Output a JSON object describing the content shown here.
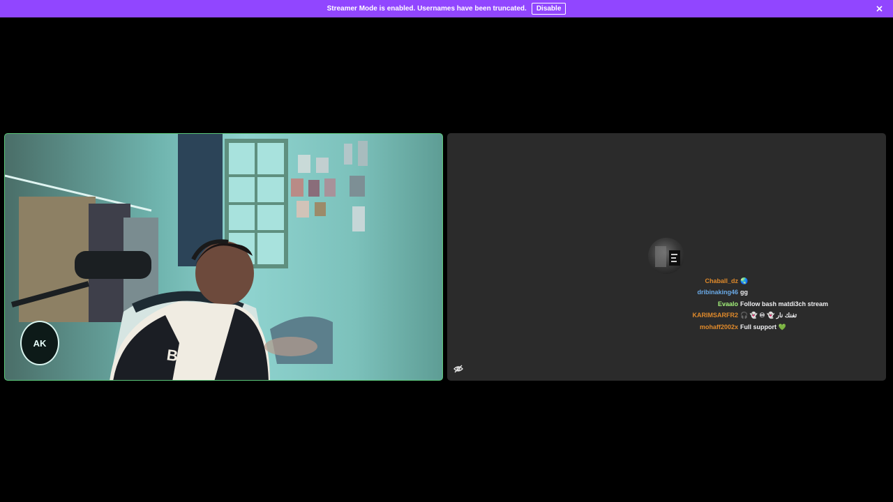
{
  "banner": {
    "message": "Streamer Mode is enabled. Usernames have been truncated.",
    "disable_label": "Disable",
    "color": "#9146ff"
  },
  "camera_tile": {
    "border_color": "#5bc97a",
    "logo_text": "AK"
  },
  "chat_tile": {
    "messages": [
      {
        "user": "Chaball_dz",
        "text": "🌏",
        "color": "#e08a2b"
      },
      {
        "user": "dribinaking46",
        "text": "gg",
        "color": "#6aa9e6"
      },
      {
        "user": "Evaalo",
        "text": "Follow bash matdi3ch stream",
        "color": "#a3f07a"
      },
      {
        "user": "KARIMSARFR2",
        "text": "🎧 👻 ♾ 👻 تفنك نار",
        "color": "#e08a2b"
      },
      {
        "user": "mohaff2002x",
        "text": "Full support 💚",
        "color": "#e08a2b"
      }
    ]
  },
  "icons": {
    "banner_close": "close-icon",
    "hide_video": "eye-off-icon",
    "logo": "eagle-logo-icon"
  }
}
